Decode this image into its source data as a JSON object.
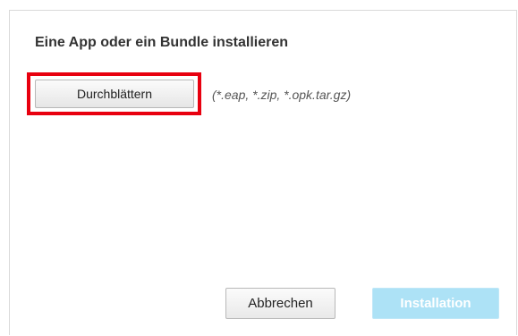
{
  "dialog": {
    "title": "Eine App oder ein Bundle installieren",
    "browse_label": "Durchblättern",
    "file_types": "(*.eap, *.zip, *.opk.tar.gz)",
    "cancel_label": "Abbrechen",
    "install_label": "Installation",
    "install_disabled": true
  },
  "colors": {
    "highlight": "#e8000f",
    "install_button": "#ade2f6",
    "title_text": "#333333"
  }
}
